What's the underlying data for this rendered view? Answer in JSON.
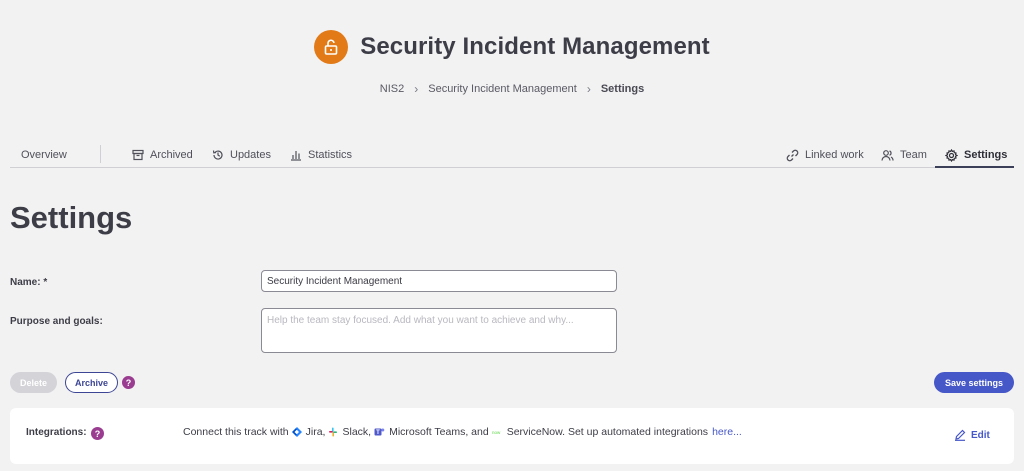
{
  "header": {
    "title": "Security Incident Management",
    "breadcrumb": [
      "NIS2",
      "Security Incident Management",
      "Settings"
    ]
  },
  "tabs": {
    "overview": "Overview",
    "archived": "Archived",
    "updates": "Updates",
    "statistics": "Statistics",
    "linked_work": "Linked work",
    "team": "Team",
    "settings": "Settings",
    "active": "settings"
  },
  "form": {
    "heading": "Settings",
    "name_label": "Name: *",
    "name_value": "Security Incident Management",
    "purpose_label": "Purpose and goals:",
    "purpose_placeholder": "Help the team stay focused. Add what you want to achieve and why..."
  },
  "actions": {
    "delete": "Delete",
    "archive": "Archive",
    "help": "?",
    "save": "Save settings"
  },
  "integrations": {
    "label": "Integrations:",
    "help": "?",
    "text_prefix": "Connect this track with",
    "jira": "Jira,",
    "slack": "Slack,",
    "teams": "Microsoft Teams, and",
    "servicenow": "ServiceNow. Set up automated integrations",
    "link": "here...",
    "edit": "Edit"
  },
  "colors": {
    "accent": "#4657c8",
    "badge": "#e27b17",
    "help": "#9a3d91",
    "archive_border": "#3d4694"
  },
  "icons": [
    "unlock-icon",
    "archive-box-icon",
    "history-icon",
    "bar-chart-icon",
    "link-icon",
    "team-icon",
    "gear-icon",
    "question-icon",
    "jira-icon",
    "slack-icon",
    "teams-icon",
    "servicenow-icon",
    "pencil-icon"
  ]
}
